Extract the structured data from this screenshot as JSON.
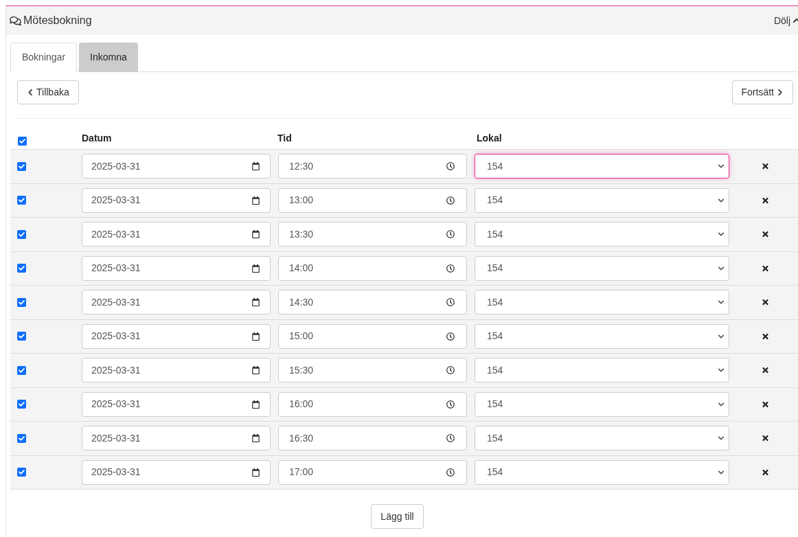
{
  "panel": {
    "title": "Mötesbokning",
    "toggle": "Dölj",
    "expanded": true
  },
  "tabs": [
    {
      "label": "Bokningar",
      "selected": true
    },
    {
      "label": "Inkomna",
      "selected": false
    }
  ],
  "nav": {
    "back": "Tillbaka",
    "next": "Fortsätt"
  },
  "table": {
    "select_all": {
      "checked": true
    },
    "columns": [
      "Datum",
      "Tid",
      "Lokal"
    ],
    "rows": [
      {
        "checked": true,
        "date": "2025-03-31",
        "time": "12:30",
        "room": "154",
        "focused": true
      },
      {
        "checked": true,
        "date": "2025-03-31",
        "time": "13:00",
        "room": "154",
        "focused": false
      },
      {
        "checked": true,
        "date": "2025-03-31",
        "time": "13:30",
        "room": "154",
        "focused": false
      },
      {
        "checked": true,
        "date": "2025-03-31",
        "time": "14:00",
        "room": "154",
        "focused": false
      },
      {
        "checked": true,
        "date": "2025-03-31",
        "time": "14:30",
        "room": "154",
        "focused": false
      },
      {
        "checked": true,
        "date": "2025-03-31",
        "time": "15:00",
        "room": "154",
        "focused": false
      },
      {
        "checked": true,
        "date": "2025-03-31",
        "time": "15:30",
        "room": "154",
        "focused": false
      },
      {
        "checked": true,
        "date": "2025-03-31",
        "time": "16:00",
        "room": "154",
        "focused": false
      },
      {
        "checked": true,
        "date": "2025-03-31",
        "time": "16:30",
        "room": "154",
        "focused": false
      },
      {
        "checked": true,
        "date": "2025-03-31",
        "time": "17:00",
        "room": "154",
        "focused": false
      }
    ]
  },
  "add_button": "Lägg till"
}
